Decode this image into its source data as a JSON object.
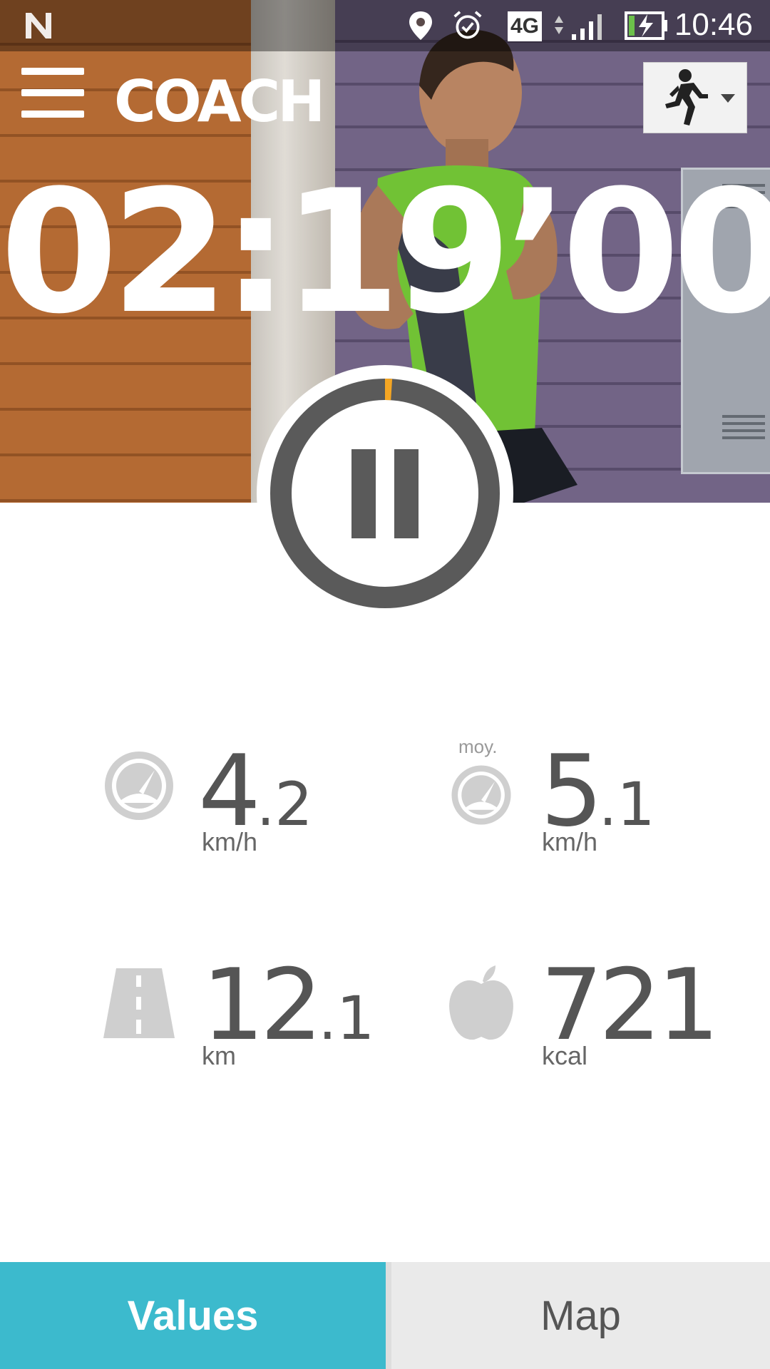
{
  "status_bar": {
    "time": "10:46",
    "network": "4G",
    "icons": [
      "n-logo-icon",
      "location-pin-icon",
      "alarm-icon",
      "network-4g-icon",
      "signal-icon",
      "battery-charging-icon"
    ]
  },
  "app_bar": {
    "logo": "COACH",
    "menu_icon": "hamburger-menu-icon",
    "activity_icon": "running-person-icon"
  },
  "timer": {
    "display": "02:19’00"
  },
  "pause_button": {
    "icon": "pause-icon",
    "progress_fraction": 0.01,
    "progress_color": "#f5a623"
  },
  "stats": {
    "speed": {
      "int": "4",
      "dec": "2",
      "unit": "km/h",
      "icon": "speedometer-icon"
    },
    "avg_speed": {
      "label": "moy.",
      "int": "5",
      "dec": "1",
      "unit": "km/h",
      "icon": "speedometer-icon"
    },
    "distance": {
      "int": "12",
      "dec": "1",
      "unit": "km",
      "icon": "road-icon"
    },
    "calories": {
      "value": "721",
      "unit": "kcal",
      "icon": "apple-icon"
    }
  },
  "tabs": [
    {
      "label": "Values",
      "active": true
    },
    {
      "label": "Map",
      "active": false
    }
  ],
  "colors": {
    "accent": "#3cbacd",
    "stat_text": "#555555",
    "icon_gray": "#cfcfcf",
    "ring": "#5a5a5a"
  }
}
